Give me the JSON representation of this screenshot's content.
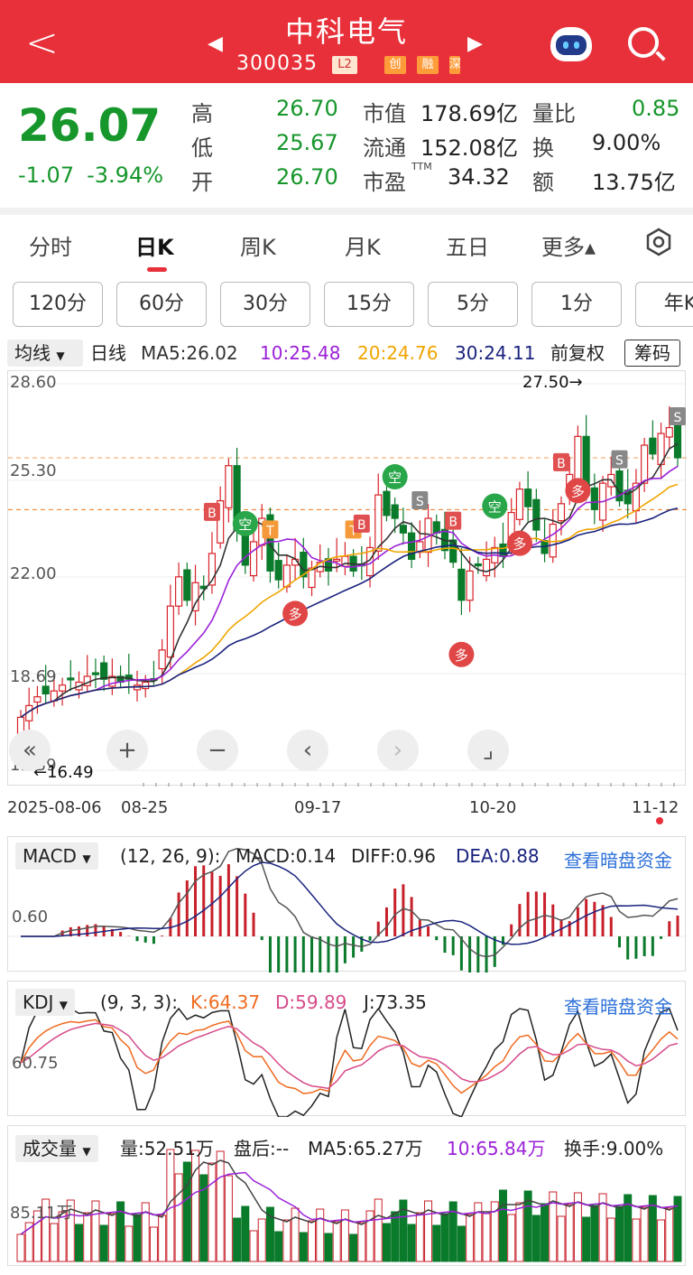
{
  "header": {
    "title": "中科电气",
    "code": "300035",
    "tags": [
      "L2",
      "创",
      "融",
      "深"
    ]
  },
  "quote": {
    "price": "26.07",
    "change": "-1.07",
    "pct": "-3.94%",
    "high_label": "高",
    "high": "26.70",
    "low_label": "低",
    "low": "25.67",
    "open_label": "开",
    "open": "26.70",
    "mcap_label": "市值",
    "mcap": "178.69亿",
    "float_label": "流通",
    "float": "152.08亿",
    "pe_label": "市盈",
    "pe_sup": "TTM",
    "pe": "34.32",
    "vr_label": "量比",
    "vr": "0.85",
    "turn_label": "换",
    "turn": "9.00%",
    "amt_label": "额",
    "amt": "13.75亿"
  },
  "tabs": [
    "分时",
    "日K",
    "周K",
    "月K",
    "五日",
    "更多▴"
  ],
  "periods": [
    "120分",
    "60分",
    "30分",
    "15分",
    "5分",
    "1分",
    "年K"
  ],
  "ma": {
    "dropdown": "均线",
    "kind": "日线",
    "ma5": "MA5:26.02",
    "ma10": "10:25.48",
    "ma20": "20:24.76",
    "ma30": "30:24.11",
    "fq": "前复权",
    "chips": "筹码",
    "colors": {
      "ma5": "#333333",
      "ma10": "#9b22d8",
      "ma20": "#f0a500",
      "ma30": "#1a237e"
    }
  },
  "kline": {
    "ylabels": [
      "28.60",
      "25.30",
      "22.00",
      "18.69",
      "15.39"
    ],
    "max_marker": "27.50→",
    "min_marker": "←16.49",
    "dates": [
      "2025-08-06",
      "08-25",
      "09-17",
      "10-20",
      "11-12"
    ],
    "signals": {
      "buy": "B",
      "sell": "S",
      "t": "T",
      "kong": "空",
      "duo": "多"
    }
  },
  "controls": [
    "«",
    "+",
    "−",
    "‹",
    "›",
    "⌟"
  ],
  "macd": {
    "dropdown": "MACD",
    "params": "(12, 26, 9):",
    "macd": "MACD:0.14",
    "diff": "DIFF:0.96",
    "dea": "DEA:0.88",
    "link": "查看暗盘资金",
    "ylabel": "0.60"
  },
  "kdj": {
    "dropdown": "KDJ",
    "params": "(9, 3, 3):",
    "k": "K:64.37",
    "d": "D:59.89",
    "j": "J:73.35",
    "link": "查看暗盘资金",
    "ylabel": "60.75"
  },
  "vol": {
    "dropdown": "成交量",
    "vol": "量:52.51万",
    "after": "盘后:--",
    "ma5": "MA5:65.27万",
    "ma10": "10:65.84万",
    "turn": "换手:9.00%",
    "ylabel": "85.11万"
  },
  "chart_data": {
    "type": "candlestick",
    "closes": [
      17.2,
      17.6,
      17.9,
      18.0,
      18.1,
      18.3,
      18.5,
      18.4,
      18.6,
      18.7,
      18.5,
      18.6,
      18.4,
      18.5,
      18.3,
      18.4,
      18.5,
      19.5,
      21.0,
      22.0,
      21.2,
      21.8,
      21.6,
      22.8,
      24.6,
      25.8,
      23.6,
      22.4,
      23.2,
      24.0,
      22.2,
      21.9,
      22.4,
      22.6,
      22.0,
      22.3,
      22.5,
      22.2,
      22.6,
      22.7,
      22.2,
      22.4,
      23.0,
      24.8,
      24.1,
      24.0,
      23.5,
      22.6,
      23.2,
      24.0,
      23.5,
      22.9,
      22.5,
      21.2,
      22.2,
      22.4,
      22.6,
      23.0,
      22.7,
      24.2,
      25.0,
      24.4,
      23.6,
      22.8,
      23.8,
      24.5,
      25.5,
      26.8,
      24.8,
      24.3,
      25.2,
      25.5,
      24.6,
      24.5,
      25.2,
      26.5,
      26.2,
      26.9,
      27.1,
      26.07
    ],
    "ylim": [
      15.39,
      28.6
    ]
  }
}
